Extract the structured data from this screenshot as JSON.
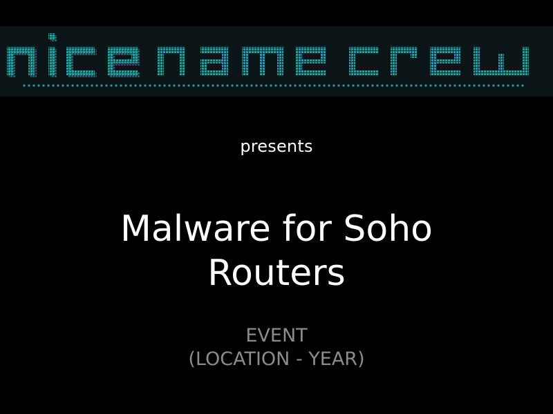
{
  "logo": {
    "text": "nice name crew",
    "style": "ascii-art banner",
    "color": "#2e9aa5",
    "shadow_color": "#1c5f66",
    "background": "#0b1416"
  },
  "slide": {
    "presents": "presents",
    "title_line1": "Malware for Soho",
    "title_line2": "Routers",
    "event": "EVENT",
    "location_year": "(LOCATION - YEAR)"
  },
  "colors": {
    "background": "#000000",
    "title": "#ffffff",
    "event_text": "#8c8c8c"
  }
}
